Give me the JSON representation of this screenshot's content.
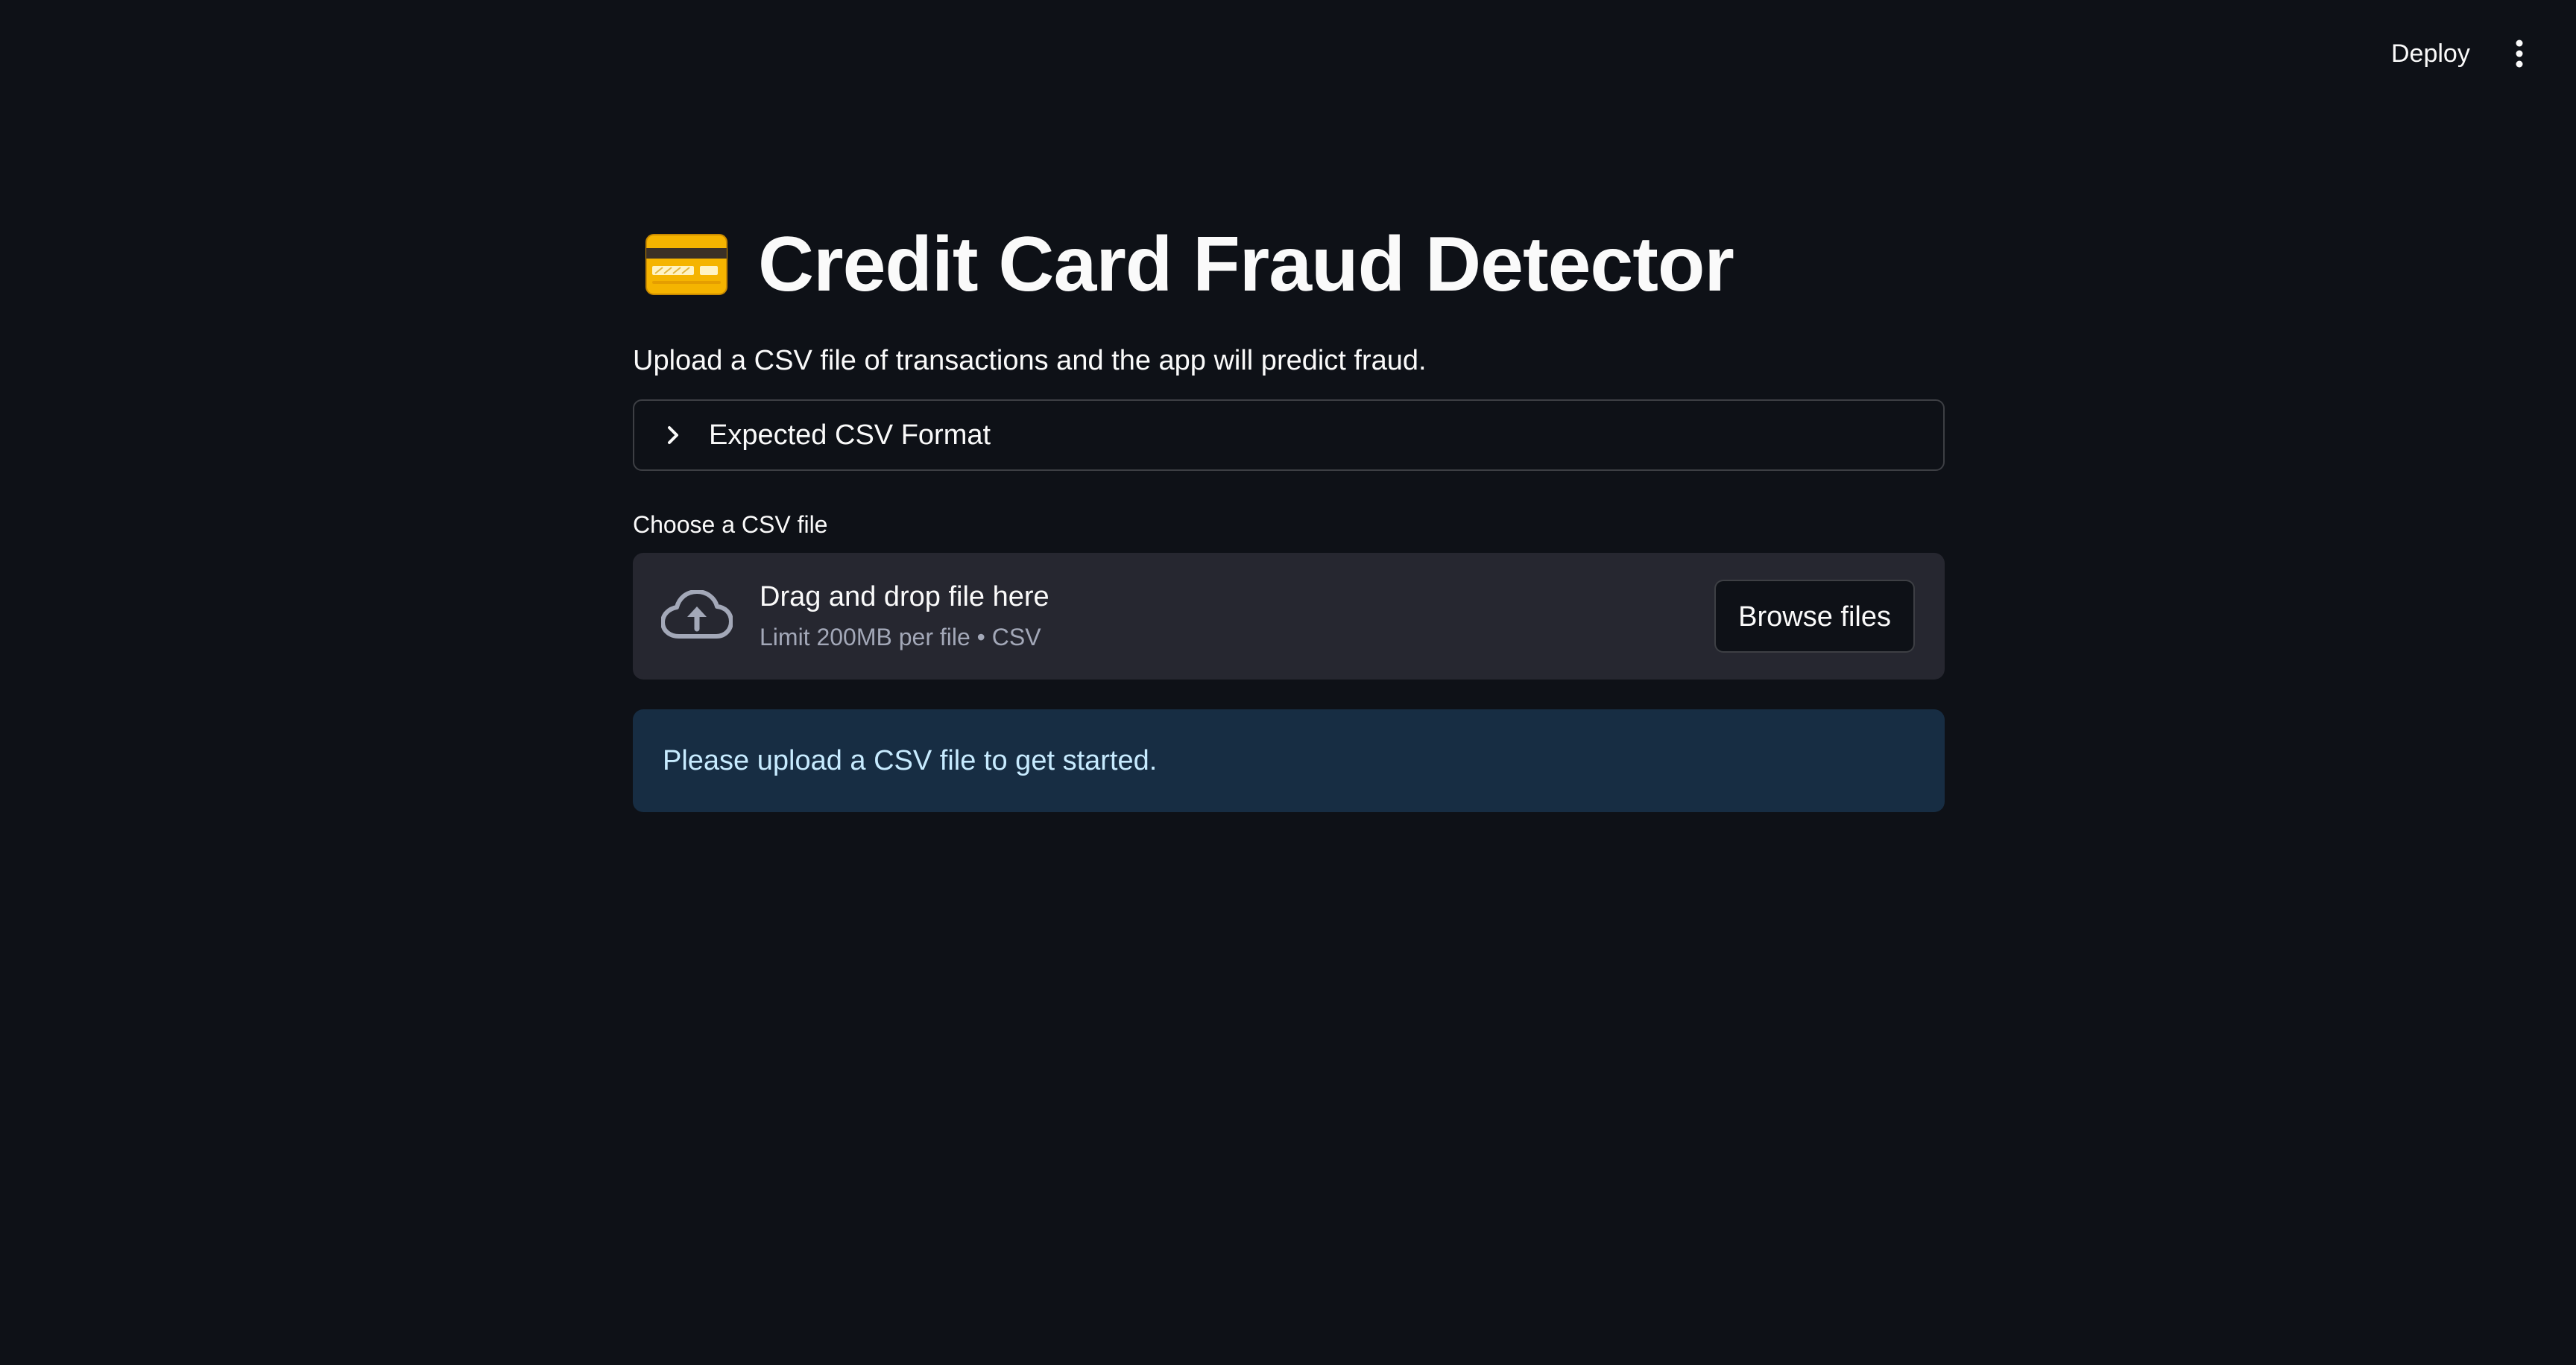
{
  "header": {
    "deploy_label": "Deploy",
    "menu_icon": "vertical-ellipsis-icon"
  },
  "main": {
    "title_icon": "credit-card-icon",
    "title": "Credit Card Fraud Detector",
    "subtitle": "Upload a CSV file of transactions and the app will predict fraud.",
    "expander": {
      "label": "Expected CSV Format",
      "icon": "chevron-right-icon",
      "expanded": false
    },
    "uploader": {
      "label": "Choose a CSV file",
      "icon": "cloud-upload-icon",
      "drop_text": "Drag and drop file here",
      "limit_text": "Limit 200MB per file • CSV",
      "browse_label": "Browse files"
    },
    "info_message": "Please upload a CSV file to get started."
  },
  "colors": {
    "background": "#0e1117",
    "dropzone": "#262730",
    "info_bg": "#172d43",
    "info_text": "#c7ebff",
    "card_yellow": "#f5b400"
  }
}
